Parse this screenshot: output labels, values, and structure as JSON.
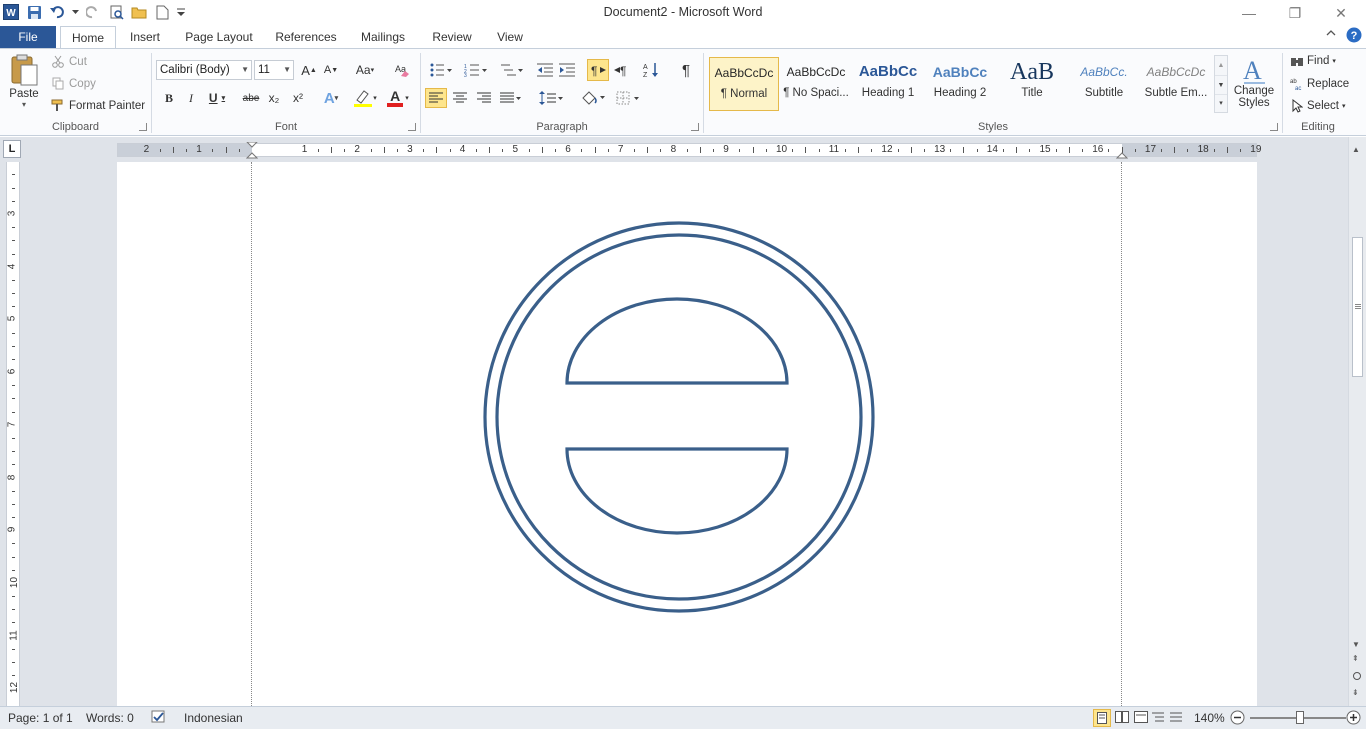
{
  "window": {
    "title": "Document2  -  Microsoft Word",
    "minimize": "—",
    "restore": "❐",
    "close": "✕"
  },
  "tabs": [
    "File",
    "Home",
    "Insert",
    "Page Layout",
    "References",
    "Mailings",
    "Review",
    "View"
  ],
  "clipboard": {
    "paste": "Paste",
    "cut": "Cut",
    "copy": "Copy",
    "format_painter": "Format Painter",
    "label": "Clipboard"
  },
  "font": {
    "family": "Calibri (Body)",
    "size": "11",
    "grow": "A",
    "shrink": "A",
    "change_case": "Aa",
    "bold": "B",
    "italic": "I",
    "underline": "U",
    "strike": "abe",
    "subscript": "x₂",
    "superscript": "x²",
    "effects": "A",
    "font_color": "A",
    "label": "Font"
  },
  "paragraph": {
    "pilcrow": "¶",
    "label": "Paragraph"
  },
  "styles": {
    "items": [
      {
        "preview": "AaBbCcDc",
        "name": "¶ Normal"
      },
      {
        "preview": "AaBbCcDc",
        "name": "¶ No Spaci..."
      },
      {
        "preview": "AaBbCc",
        "name": "Heading 1"
      },
      {
        "preview": "AaBbCc",
        "name": "Heading 2"
      },
      {
        "preview": "AaB",
        "name": "Title"
      },
      {
        "preview": "AaBbCc.",
        "name": "Subtitle"
      },
      {
        "preview": "AaBbCcDc",
        "name": "Subtle Em..."
      }
    ],
    "change_styles_1": "Change",
    "change_styles_2": "Styles",
    "label": "Styles"
  },
  "editing": {
    "find": "Find",
    "replace": "Replace",
    "select": "Select",
    "label": "Editing"
  },
  "ruler": {
    "corner": "L",
    "h_labels": [
      "2",
      "1",
      "1",
      "2",
      "3",
      "4",
      "5",
      "6",
      "7",
      "8",
      "9",
      "10",
      "11",
      "12",
      "13",
      "14",
      "15",
      "16",
      "17",
      "18",
      "19"
    ],
    "v_labels": [
      "3",
      "4",
      "5",
      "6",
      "7",
      "8",
      "9",
      "10",
      "11",
      "12"
    ]
  },
  "document": {
    "shape_color": "#3a5f8a"
  },
  "status": {
    "page": "Page: 1 of 1",
    "words": "Words: 0",
    "language": "Indonesian",
    "zoom": "140%"
  },
  "colors": {
    "file_tab": "#2b5797",
    "highlight": "#fde58d",
    "font_color_bar": "#e02020",
    "highlight_bar": "#ffff00"
  }
}
